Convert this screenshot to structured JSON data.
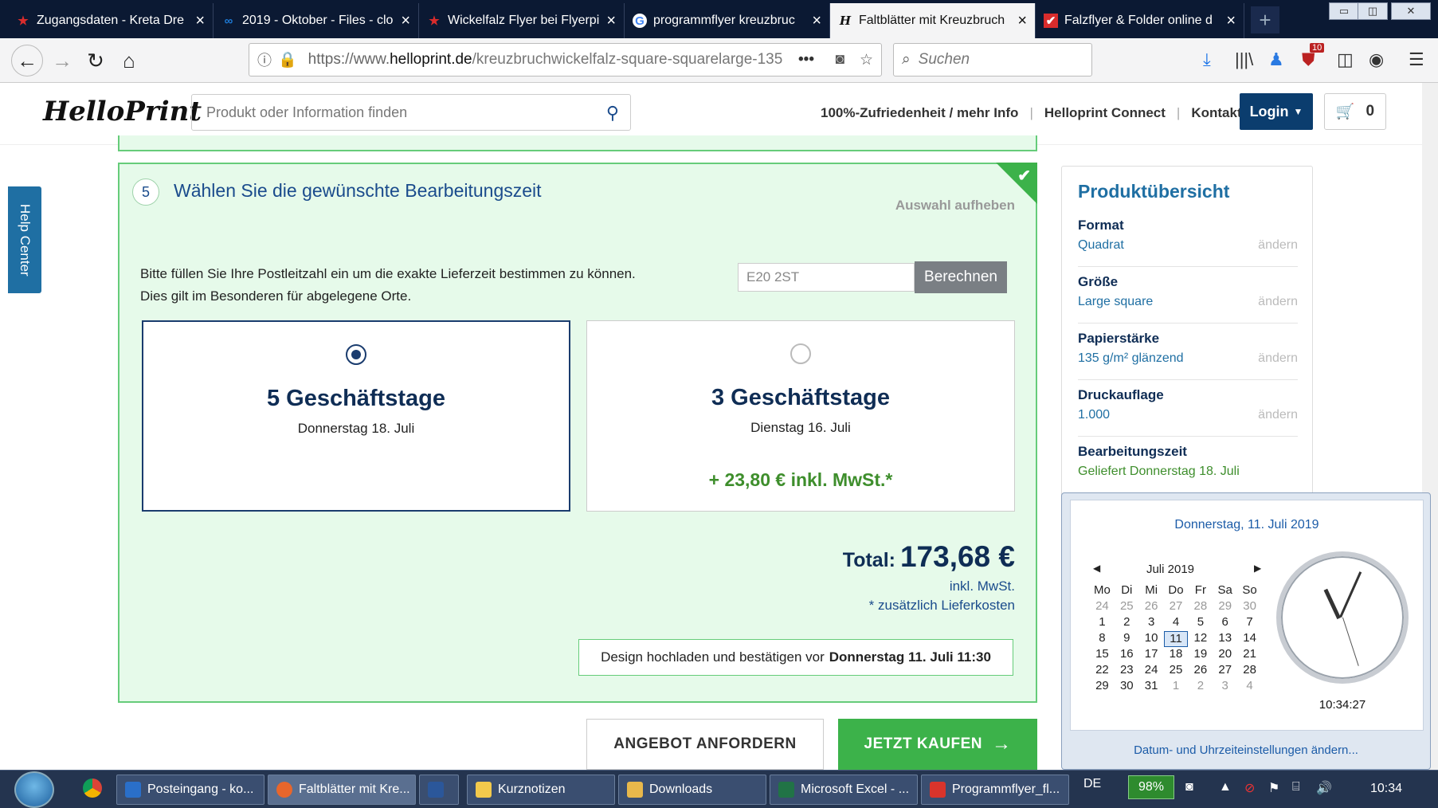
{
  "browser": {
    "tabs": [
      {
        "label": "Zugangsdaten - Kreta Dre",
        "icon": "star-icon",
        "color": "#d92c2c"
      },
      {
        "label": "2019 - Oktober - Files - clo",
        "icon": "cloud-icon",
        "color": "#1d7ad6"
      },
      {
        "label": "Wickelfalz Flyer bei Flyerpi",
        "icon": "star-icon",
        "color": "#d92c2c"
      },
      {
        "label": "programmflyer kreuzbruc",
        "icon": "google-icon",
        "color": "#4285f4"
      },
      {
        "label": "Faltblätter mit Kreuzbruch",
        "icon": "helloprint-icon",
        "color": "#111111"
      },
      {
        "label": "Falzflyer & Folder online d",
        "icon": "check-icon",
        "color": "#d92c2c"
      }
    ],
    "active_tab": 4,
    "url_prefix": "https://www.",
    "url_domain": "helloprint.de",
    "url_path": "/kreuzbruchwickelfalz-square-squarelarge-135",
    "search_placeholder": "Suchen",
    "badge_count": "10"
  },
  "site": {
    "logo": "HelloPrint",
    "search_placeholder": "Produkt oder Information finden",
    "links": [
      "100%-Zufriedenheit / mehr Info",
      "Helloprint Connect",
      "Kontakt"
    ],
    "login": "Login",
    "cart_count": "0",
    "help_center": "Help Center"
  },
  "step": {
    "number": "5",
    "title": "Wählen Sie die gewünschte Bearbeitungszeit",
    "reset": "Auswahl aufheben",
    "plz_text": "Bitte füllen Sie Ihre Postleitzahl ein um die exakte Lieferzeit bestimmen zu können. Dies gilt im Besonderen für abgelegene Orte.",
    "plz_value": "E20 2ST",
    "calc_label": "Berechnen",
    "options": [
      {
        "days": "5 Geschäftstage",
        "date": "Donnerstag 18. Juli",
        "price": "",
        "selected": true
      },
      {
        "days": "3 Geschäftstage",
        "date": "Dienstag 16. Juli",
        "price": "+ 23,80 € inkl. MwSt.*",
        "selected": false
      }
    ],
    "total_label": "Total:",
    "total_value": "173,68 €",
    "vat_note": "inkl. MwSt.",
    "shipping_note": "* zusätzlich Lieferkosten",
    "deadline_text": "Design hochladen und bestätigen vor",
    "deadline_date": "Donnerstag 11. Juli 11:30"
  },
  "actions": {
    "quote": "ANGEBOT ANFORDERN",
    "buy": "JETZT KAUFEN"
  },
  "overview": {
    "title": "Produktübersicht",
    "change_label": "ändern",
    "rows": [
      {
        "label": "Format",
        "value": "Quadrat"
      },
      {
        "label": "Größe",
        "value": "Large square"
      },
      {
        "label": "Papierstärke",
        "value": "135 g/m² glänzend"
      },
      {
        "label": "Druckauflage",
        "value": "1.000"
      },
      {
        "label": "Bearbeitungszeit",
        "value": "Geliefert Donnerstag 18. Juli"
      }
    ]
  },
  "calendar": {
    "header": "Donnerstag, 11. Juli 2019",
    "month": "Juli 2019",
    "weekdays": [
      "Mo",
      "Di",
      "Mi",
      "Do",
      "Fr",
      "Sa",
      "So"
    ],
    "weeks": [
      [
        "24",
        "25",
        "26",
        "27",
        "28",
        "29",
        "30"
      ],
      [
        "1",
        "2",
        "3",
        "4",
        "5",
        "6",
        "7"
      ],
      [
        "8",
        "9",
        "10",
        "11",
        "12",
        "13",
        "14"
      ],
      [
        "15",
        "16",
        "17",
        "18",
        "19",
        "20",
        "21"
      ],
      [
        "22",
        "23",
        "24",
        "25",
        "26",
        "27",
        "28"
      ],
      [
        "29",
        "30",
        "31",
        "1",
        "2",
        "3",
        "4"
      ]
    ],
    "today": "11",
    "time": "10:34:27",
    "settings_link": "Datum- und Uhrzeiteinstellungen ändern..."
  },
  "taskbar": {
    "items": [
      {
        "label": "Posteingang - ko...",
        "color": "#2a6fc9"
      },
      {
        "label": "Faltblätter mit Kre...",
        "color": "#e8662b"
      },
      {
        "label": "",
        "color": "#2b579a"
      },
      {
        "label": "Kurznotizen",
        "color": "#f2c94c"
      },
      {
        "label": "Downloads",
        "color": "#e8b84b"
      },
      {
        "label": "Microsoft Excel - ...",
        "color": "#217346"
      },
      {
        "label": "Programmflyer_fl...",
        "color": "#d9342b"
      }
    ],
    "language": "DE",
    "battery": "98%",
    "clock": "10:34"
  },
  "colors": {
    "brand_blue": "#0b3d6e",
    "accent_green": "#3cb24a",
    "panel_green": "#e6faea"
  }
}
